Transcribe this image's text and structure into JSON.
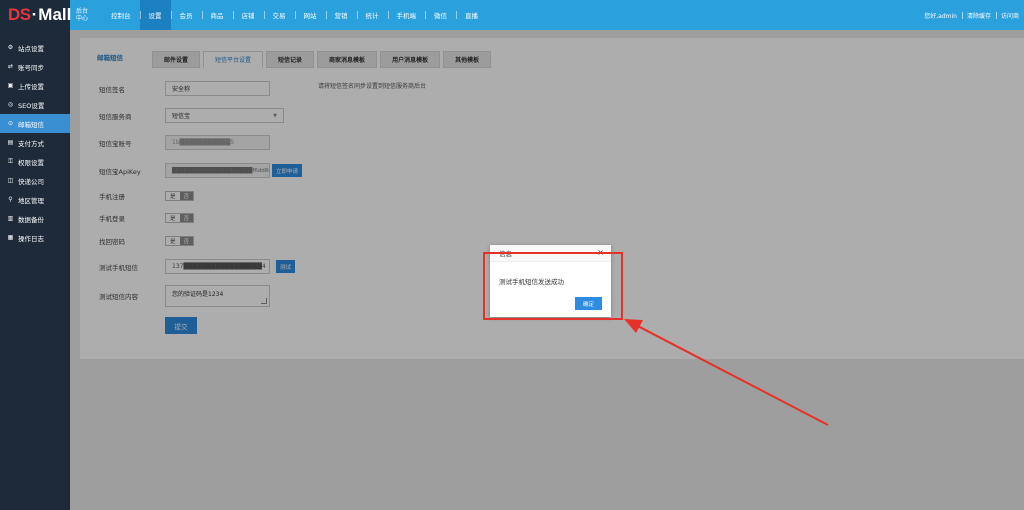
{
  "logo": {
    "ds": "DS",
    "dot": "·",
    "mall": "Mall",
    "sub": "后台中心"
  },
  "nav": [
    "控制台",
    "设置",
    "会员",
    "商品",
    "店铺",
    "交易",
    "网站",
    "营销",
    "统计",
    "手机端",
    "微信",
    "直播"
  ],
  "nav_active": 1,
  "topright": {
    "greeting": "您好,admin",
    "clear_cache": "清除缓存",
    "visit": "访问商"
  },
  "sidebar": {
    "items": [
      {
        "label": "站点设置",
        "icon": "gear-icon",
        "glyph": "⚙"
      },
      {
        "label": "账号同步",
        "icon": "sync-icon",
        "glyph": "⇄"
      },
      {
        "label": "上传设置",
        "icon": "image-icon",
        "glyph": "▣"
      },
      {
        "label": "SEO设置",
        "icon": "seo-icon",
        "glyph": "◎"
      },
      {
        "label": "邮箱短信",
        "icon": "mail-icon",
        "glyph": "⊙"
      },
      {
        "label": "支付方式",
        "icon": "payment-icon",
        "glyph": "▤"
      },
      {
        "label": "权限设置",
        "icon": "lock-icon",
        "glyph": "⚿"
      },
      {
        "label": "快递公司",
        "icon": "truck-icon",
        "glyph": "◫"
      },
      {
        "label": "地区管理",
        "icon": "location-icon",
        "glyph": "⚲"
      },
      {
        "label": "数据备份",
        "icon": "database-icon",
        "glyph": "▥"
      },
      {
        "label": "操作日志",
        "icon": "log-icon",
        "glyph": "▦"
      }
    ],
    "active": 4
  },
  "tabs": {
    "title": "邮箱短信",
    "items": [
      "邮件设置",
      "短信平台设置",
      "短信记录",
      "商家消息模板",
      "用户消息模板",
      "其他模板"
    ],
    "active": 1
  },
  "form": {
    "sign_label": "短信签名",
    "sign_value": "安全称",
    "sign_hint": "请将短信签名同步设置到短信服务商后台",
    "provider_label": "短信服务商",
    "provider_value": "短信宝",
    "account_label": "短信宝账号",
    "account_value": "1b███████████5",
    "apikey_label": "短信宝ApiKey",
    "apikey_value": "███████████████████f6dd8d0a06e3781e971",
    "apikey_button": "立即申请",
    "register_label": "手机注册",
    "login_label": "手机登录",
    "findpwd_label": "找回密码",
    "toggle_on": "是",
    "toggle_off": "否",
    "test_phone_label": "测试手机短信",
    "test_phone_value": "137█████████████████4",
    "test_button": "测试",
    "test_content_label": "测试短信内容",
    "test_content_value": "您的验证码是1234",
    "submit": "提交"
  },
  "dialog": {
    "title": "信息",
    "close": "×",
    "message": "测试手机短信发送成功",
    "ok": "确定"
  },
  "colors": {
    "topbar": "#2aa0dd",
    "sidebar": "#1e2a3a",
    "accent": "#2d8ce0",
    "annotation": "#e8302a"
  }
}
